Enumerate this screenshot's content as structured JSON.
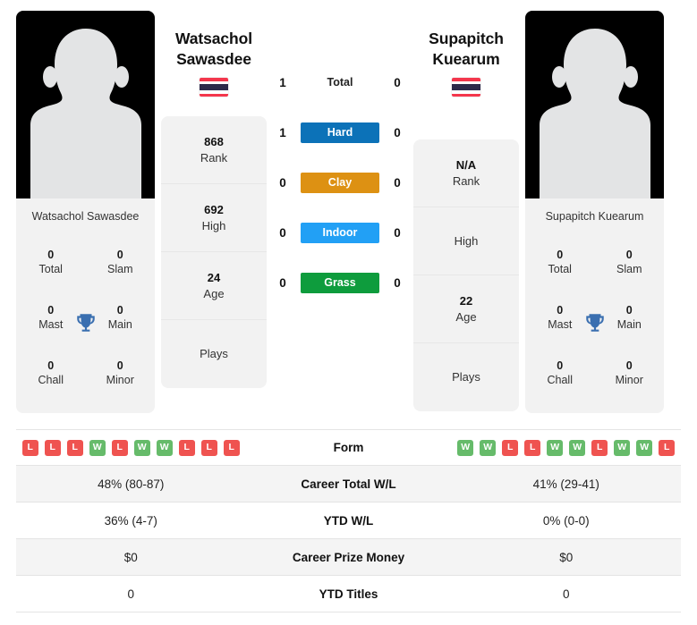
{
  "colors": {
    "win": "#66bb6a",
    "loss": "#ef5350",
    "hard": "#0c72b8",
    "clay": "#dd9113",
    "indoor": "#22a0f5",
    "grass": "#0e9c3d",
    "card_bg": "#f2f2f2",
    "row_alt": "#f4f4f4"
  },
  "players": {
    "left": {
      "first_name": "Watsachol",
      "last_name": "Sawasdee",
      "full_name": "Watsachol Sawasdee",
      "country": "Thailand",
      "flag_icon": "thailand-flag-icon",
      "avatar_icon": "player-silhouette-icon",
      "titles": [
        {
          "value": "0",
          "label": "Total"
        },
        {
          "value": "0",
          "label": "Slam"
        },
        {
          "value": "0",
          "label": "Mast"
        },
        {
          "value": "0",
          "label": "Main"
        },
        {
          "value": "0",
          "label": "Chall"
        },
        {
          "value": "0",
          "label": "Minor"
        }
      ],
      "info": [
        {
          "value": "868",
          "label": "Rank"
        },
        {
          "value": "692",
          "label": "High"
        },
        {
          "value": "24",
          "label": "Age"
        },
        {
          "value": "",
          "label": "Plays"
        }
      ],
      "form": [
        "L",
        "L",
        "L",
        "W",
        "L",
        "W",
        "W",
        "L",
        "L",
        "L"
      ],
      "career_total_wl": "48% (80-87)",
      "ytd_wl": "36% (4-7)",
      "career_prize_money": "$0",
      "ytd_titles": "0"
    },
    "right": {
      "first_name": "Supapitch",
      "last_name": "Kuearum",
      "full_name": "Supapitch Kuearum",
      "country": "Thailand",
      "flag_icon": "thailand-flag-icon",
      "avatar_icon": "player-silhouette-icon",
      "titles": [
        {
          "value": "0",
          "label": "Total"
        },
        {
          "value": "0",
          "label": "Slam"
        },
        {
          "value": "0",
          "label": "Mast"
        },
        {
          "value": "0",
          "label": "Main"
        },
        {
          "value": "0",
          "label": "Chall"
        },
        {
          "value": "0",
          "label": "Minor"
        }
      ],
      "info": [
        {
          "value": "N/A",
          "label": "Rank"
        },
        {
          "value": "",
          "label": "High"
        },
        {
          "value": "22",
          "label": "Age"
        },
        {
          "value": "",
          "label": "Plays"
        }
      ],
      "form": [
        "W",
        "W",
        "L",
        "L",
        "W",
        "W",
        "L",
        "W",
        "W",
        "L"
      ],
      "career_total_wl": "41% (29-41)",
      "ytd_wl": "0% (0-0)",
      "career_prize_money": "$0",
      "ytd_titles": "0"
    }
  },
  "head_to_head": [
    {
      "label": "Total",
      "left": "1",
      "right": "0",
      "color": ""
    },
    {
      "label": "Hard",
      "left": "1",
      "right": "0",
      "color": "#0c72b8"
    },
    {
      "label": "Clay",
      "left": "0",
      "right": "0",
      "color": "#dd9113"
    },
    {
      "label": "Indoor",
      "left": "0",
      "right": "0",
      "color": "#22a0f5"
    },
    {
      "label": "Grass",
      "left": "0",
      "right": "0",
      "color": "#0e9c3d"
    }
  ],
  "table": {
    "form_label": "Form",
    "rows": [
      {
        "label": "Career Total W/L",
        "left": "48% (80-87)",
        "right": "41% (29-41)"
      },
      {
        "label": "YTD W/L",
        "left": "36% (4-7)",
        "right": "0% (0-0)"
      },
      {
        "label": "Career Prize Money",
        "left": "$0",
        "right": "$0"
      },
      {
        "label": "YTD Titles",
        "left": "0",
        "right": "0"
      }
    ]
  }
}
